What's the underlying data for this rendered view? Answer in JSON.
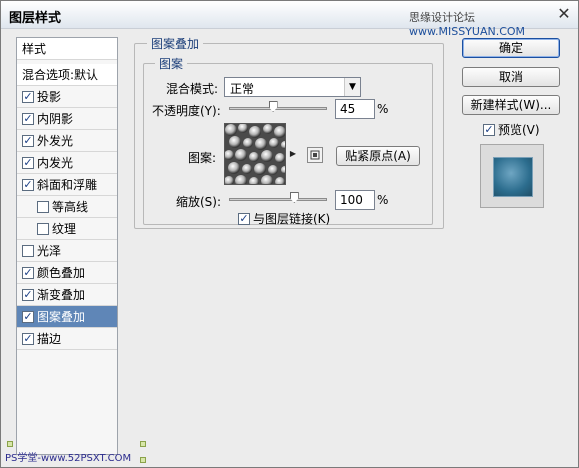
{
  "window": {
    "title": "图层样式",
    "watermark_prefix": "思缘设计论坛",
    "watermark_site": "www.MISSYUAN.COM",
    "close_glyph": "✕"
  },
  "left_panel": {
    "header": "样式",
    "blend_options": "混合选项:默认",
    "items": [
      {
        "label": "投影",
        "checked": true
      },
      {
        "label": "内阴影",
        "checked": true
      },
      {
        "label": "外发光",
        "checked": true
      },
      {
        "label": "内发光",
        "checked": true
      },
      {
        "label": "斜面和浮雕",
        "checked": true
      },
      {
        "label": "等高线",
        "checked": false
      },
      {
        "label": "纹理",
        "checked": false
      },
      {
        "label": "光泽",
        "checked": false
      },
      {
        "label": "颜色叠加",
        "checked": true
      },
      {
        "label": "渐变叠加",
        "checked": true
      },
      {
        "label": "图案叠加",
        "checked": true,
        "selected": true
      },
      {
        "label": "描边",
        "checked": true
      }
    ]
  },
  "pattern_overlay": {
    "group_title": "图案叠加",
    "sub_group_title": "图案",
    "blend_mode_label": "混合模式:",
    "blend_mode_value": "正常",
    "opacity_label": "不透明度(Y):",
    "opacity_value": "45",
    "opacity_percent": 45,
    "opacity_unit": "%",
    "pattern_label": "图案:",
    "snap_origin_button": "贴紧原点(A)",
    "scale_label": "缩放(S):",
    "scale_value": "100",
    "scale_percent": 100,
    "scale_unit": "%",
    "link_with_layer_label": "与图层链接(K)",
    "link_with_layer_checked": true
  },
  "buttons": {
    "ok": "确定",
    "cancel": "取消",
    "new_style": "新建样式(W)...",
    "preview_label": "预览(V)",
    "preview_checked": true
  },
  "bottom_watermark": "PS学堂-www.52PSXT.COM",
  "check_glyph": "✓",
  "arrow_glyph": "▼",
  "menu_glyph": "▶"
}
